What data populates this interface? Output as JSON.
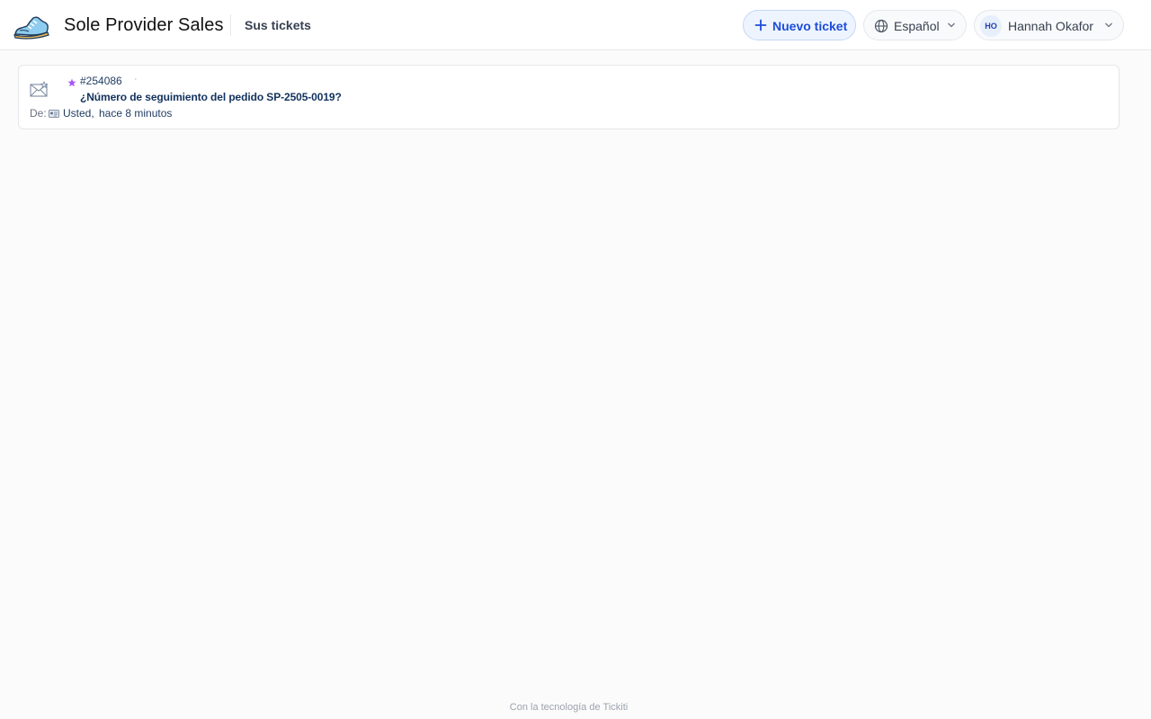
{
  "header": {
    "brand_name": "Sole Provider Sales",
    "logo_icon": "sneaker-logo",
    "nav_link": "Sus tickets",
    "new_ticket_label": "Nuevo ticket",
    "language_label": "Español",
    "user_initials": "HO",
    "user_name": "Hannah Okafor"
  },
  "tickets": [
    {
      "id": "#254086",
      "separator": "·",
      "subject": "¿Número de seguimiento del pedido SP-2505-0019?",
      "from_label": "De:",
      "from_name": "Usted,",
      "time_ago": "hace 8 minutos",
      "icon": "envelope-icon",
      "priority_icon": "star-icon"
    }
  ],
  "footer": {
    "text": "Con la tecnología de Tickiti"
  },
  "colors": {
    "accent": "#1d4ed8",
    "accent_bg": "#eef4fe",
    "subject": "#12325e",
    "star": "#a855f7"
  }
}
